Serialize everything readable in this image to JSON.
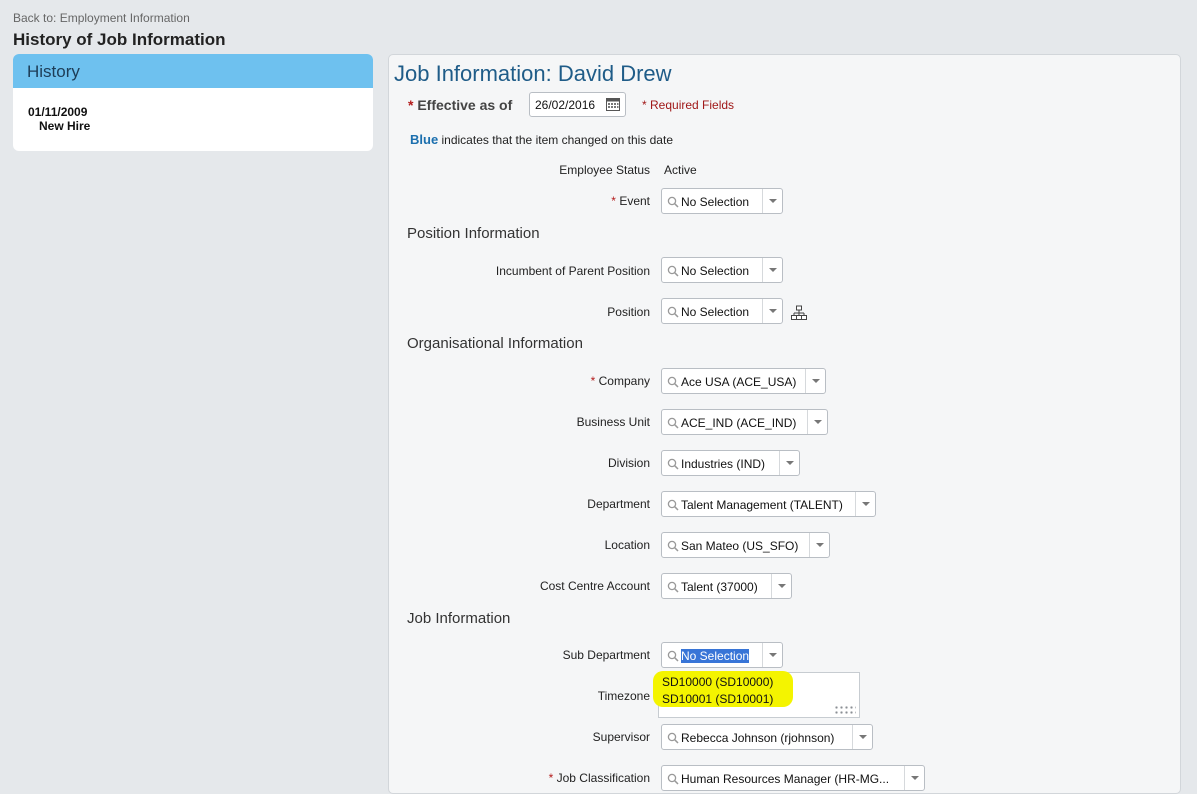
{
  "back_link": "Back to: Employment Information",
  "page_title": "History of Job Information",
  "history": {
    "title": "History",
    "entries": [
      {
        "date": "01/11/2009",
        "event": "New Hire"
      }
    ]
  },
  "form": {
    "title": "Job Information: David Drew",
    "effective_label": "Effective as of",
    "effective_date": "26/02/2016",
    "required_note": "* Required Fields",
    "blue_word": "Blue",
    "blue_note_rest": " indicates that the item changed on this date",
    "employee_status": {
      "label": "Employee Status",
      "value": "Active"
    },
    "event": {
      "label": "Event",
      "value": "No Selection"
    },
    "sections": {
      "position": "Position Information",
      "organisational": "Organisational Information",
      "job": "Job Information"
    },
    "incumbent_parent_position": {
      "label": "Incumbent of Parent Position",
      "value": "No Selection"
    },
    "position": {
      "label": "Position",
      "value": "No Selection"
    },
    "company": {
      "label": "Company",
      "value": "Ace USA (ACE_USA)"
    },
    "business_unit": {
      "label": "Business Unit",
      "value": "ACE_IND (ACE_IND)"
    },
    "division": {
      "label": "Division",
      "value": "Industries (IND)"
    },
    "department": {
      "label": "Department",
      "value": "Talent Management (TALENT)"
    },
    "location": {
      "label": "Location",
      "value": "San Mateo (US_SFO)"
    },
    "cost_centre": {
      "label": "Cost Centre Account",
      "value": "Talent (37000)"
    },
    "sub_department": {
      "label": "Sub Department",
      "value": "No Selection",
      "options": [
        "SD10000 (SD10000)",
        "SD10001 (SD10001)"
      ]
    },
    "timezone": {
      "label": "Timezone"
    },
    "supervisor": {
      "label": "Supervisor",
      "value": "Rebecca Johnson (rjohnson)"
    },
    "job_classification": {
      "label": "Job Classification",
      "value": "Human Resources Manager (HR-MG..."
    }
  },
  "colors": {
    "title_blue": "#1f5c88",
    "history_header": "#6ec1ef",
    "required_red": "#b31b1b",
    "highlight_yellow": "#f4f400"
  }
}
